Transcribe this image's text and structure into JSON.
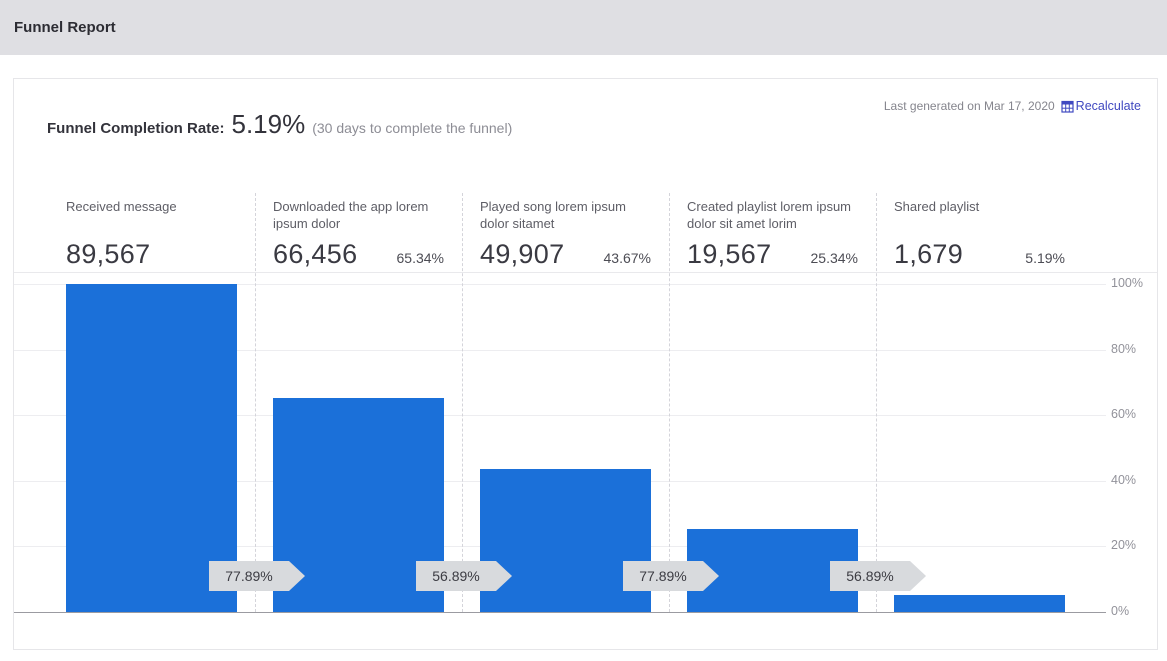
{
  "header": {
    "title": "Funnel Report"
  },
  "report": {
    "completion_label": "Funnel Completion Rate:",
    "completion_value": "5.19%",
    "completion_note": "(30 days to complete the funnel)",
    "last_generated": "Last generated on Mar 17, 2020",
    "recalculate_label": "Recalculate",
    "recalculate_icon": "calculator-grid-icon"
  },
  "chart_data": {
    "type": "bar",
    "subtype": "funnel",
    "title": "Funnel Report",
    "stages": [
      {
        "label": "Received message",
        "count": 89567,
        "count_display": "89,567",
        "percent_of_first": 100,
        "percent_display": ""
      },
      {
        "label": "Downloaded the app lorem ipsum dolor",
        "count": 66456,
        "count_display": "66,456",
        "percent_of_first": 65.34,
        "percent_display": "65.34%"
      },
      {
        "label": "Played song lorem ipsum dolor sitamet",
        "count": 49907,
        "count_display": "49,907",
        "percent_of_first": 43.67,
        "percent_display": "43.67%"
      },
      {
        "label": "Created playlist lorem ipsum dolor sit amet lorim",
        "count": 19567,
        "count_display": "19,567",
        "percent_of_first": 25.34,
        "percent_display": "25.34%"
      },
      {
        "label": "Shared playlist",
        "count": 1679,
        "count_display": "1,679",
        "percent_of_first": 5.19,
        "percent_display": "5.19%"
      }
    ],
    "step_conversion_labels": [
      "77.89%",
      "56.89%",
      "77.89%",
      "56.89%"
    ],
    "y_axis": {
      "position": "right",
      "min": 0,
      "max": 100,
      "ticks": [
        "100%",
        "80%",
        "60%",
        "40%",
        "20%",
        "0%"
      ]
    },
    "grid": true,
    "bar_color": "#1b70d9"
  },
  "colors": {
    "topbar_bg": "#dfdfe3",
    "bar_blue": "#1b70d9",
    "link_indigo": "#4049c0",
    "badge_bg": "#d8dadd",
    "text_dark": "#33333b",
    "text_gray": "#5e5e66",
    "text_light_gray": "#8d8d95"
  }
}
